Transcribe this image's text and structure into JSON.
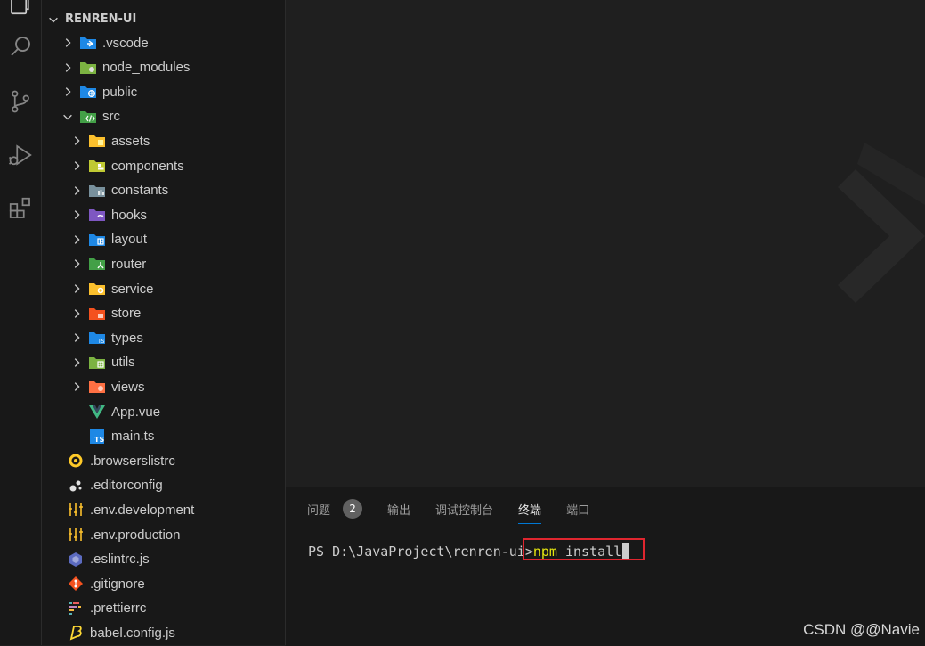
{
  "explorer": {
    "root_label": "RENREN-UI",
    "items": [
      {
        "label": ".vscode",
        "icon": "vscode-folder-icon",
        "expandable": true,
        "expanded": false,
        "depth": 0
      },
      {
        "label": "node_modules",
        "icon": "node-folder-icon",
        "expandable": true,
        "expanded": false,
        "depth": 0
      },
      {
        "label": "public",
        "icon": "public-folder-icon",
        "expandable": true,
        "expanded": false,
        "depth": 0
      },
      {
        "label": "src",
        "icon": "src-folder-icon",
        "expandable": true,
        "expanded": true,
        "depth": 0
      },
      {
        "label": "assets",
        "icon": "assets-folder-icon",
        "expandable": true,
        "expanded": false,
        "depth": 1
      },
      {
        "label": "components",
        "icon": "components-folder-icon",
        "expandable": true,
        "expanded": false,
        "depth": 1
      },
      {
        "label": "constants",
        "icon": "constants-folder-icon",
        "expandable": true,
        "expanded": false,
        "depth": 1
      },
      {
        "label": "hooks",
        "icon": "hooks-folder-icon",
        "expandable": true,
        "expanded": false,
        "depth": 1
      },
      {
        "label": "layout",
        "icon": "layout-folder-icon",
        "expandable": true,
        "expanded": false,
        "depth": 1
      },
      {
        "label": "router",
        "icon": "router-folder-icon",
        "expandable": true,
        "expanded": false,
        "depth": 1
      },
      {
        "label": "service",
        "icon": "service-folder-icon",
        "expandable": true,
        "expanded": false,
        "depth": 1
      },
      {
        "label": "store",
        "icon": "store-folder-icon",
        "expandable": true,
        "expanded": false,
        "depth": 1
      },
      {
        "label": "types",
        "icon": "types-folder-icon",
        "expandable": true,
        "expanded": false,
        "depth": 1
      },
      {
        "label": "utils",
        "icon": "utils-folder-icon",
        "expandable": true,
        "expanded": false,
        "depth": 1
      },
      {
        "label": "views",
        "icon": "views-folder-icon",
        "expandable": true,
        "expanded": false,
        "depth": 1
      },
      {
        "label": "App.vue",
        "icon": "vue-file-icon",
        "expandable": false,
        "depth": 1
      },
      {
        "label": "main.ts",
        "icon": "typescript-file-icon",
        "expandable": false,
        "depth": 1
      },
      {
        "label": ".browserslistrc",
        "icon": "browserslist-file-icon",
        "expandable": false,
        "depth": 0
      },
      {
        "label": ".editorconfig",
        "icon": "editorconfig-file-icon",
        "expandable": false,
        "depth": 0
      },
      {
        "label": ".env.development",
        "icon": "env-file-icon",
        "expandable": false,
        "depth": 0
      },
      {
        "label": ".env.production",
        "icon": "env-file-icon",
        "expandable": false,
        "depth": 0
      },
      {
        "label": ".eslintrc.js",
        "icon": "eslint-file-icon",
        "expandable": false,
        "depth": 0
      },
      {
        "label": ".gitignore",
        "icon": "git-file-icon",
        "expandable": false,
        "depth": 0
      },
      {
        "label": ".prettierrc",
        "icon": "prettier-file-icon",
        "expandable": false,
        "depth": 0
      },
      {
        "label": "babel.config.js",
        "icon": "babel-file-icon",
        "expandable": false,
        "depth": 0
      }
    ]
  },
  "panel": {
    "tabs": [
      {
        "label": "问题",
        "badge": "2",
        "active": false
      },
      {
        "label": "输出",
        "active": false
      },
      {
        "label": "调试控制台",
        "active": false
      },
      {
        "label": "终端",
        "active": true
      },
      {
        "label": "端口",
        "active": false
      }
    ],
    "terminal": {
      "prompt": "PS D:\\JavaProject\\renren-ui",
      "arrow": ">",
      "command": "npm",
      "args": " install"
    }
  },
  "colors": {
    "terminal_command": "#e5e510",
    "highlight_box": "#e0262f",
    "active_tab_underline": "#0078d4"
  },
  "watermark": "CSDN @@Navie"
}
